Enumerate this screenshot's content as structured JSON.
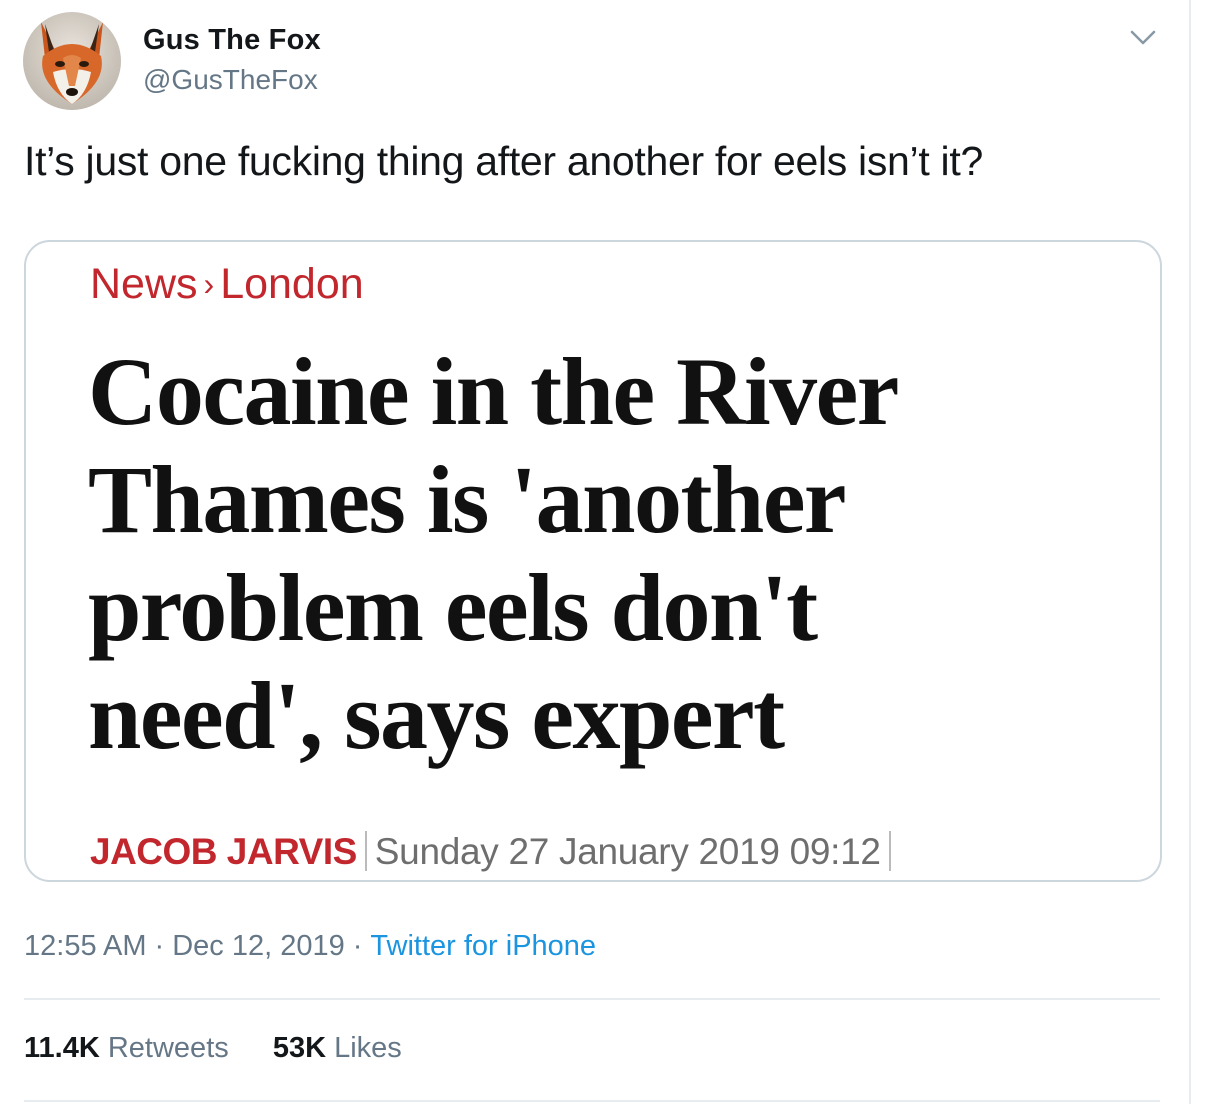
{
  "user": {
    "display_name": "Gus The Fox",
    "handle": "@GusTheFox",
    "avatar_icon": "fox-avatar"
  },
  "menu": {
    "icon": "chevron-down-icon"
  },
  "tweet": {
    "text": "It’s just one fucking thing after another for eels isn’t it?"
  },
  "card": {
    "breadcrumb": {
      "section": "News",
      "separator": "›",
      "subsection": "London"
    },
    "headline_lines": [
      "Cocaine in the River",
      "Thames is 'another",
      "problem eels don't",
      "need', says expert"
    ],
    "author": "JACOB JARVIS",
    "date": "Sunday 27 January 2019 09:12",
    "accent_color": "#c1272d"
  },
  "meta": {
    "time": "12:55 AM",
    "separator": "·",
    "date": "Dec 12, 2019",
    "source": "Twitter for iPhone"
  },
  "stats": {
    "retweets_count": "11.4K",
    "retweets_label": "Retweets",
    "likes_count": "53K",
    "likes_label": "Likes"
  },
  "colors": {
    "link": "#1b95e0",
    "secondary_text": "#657786",
    "primary_text": "#14171a",
    "border": "#ccd6dd"
  }
}
